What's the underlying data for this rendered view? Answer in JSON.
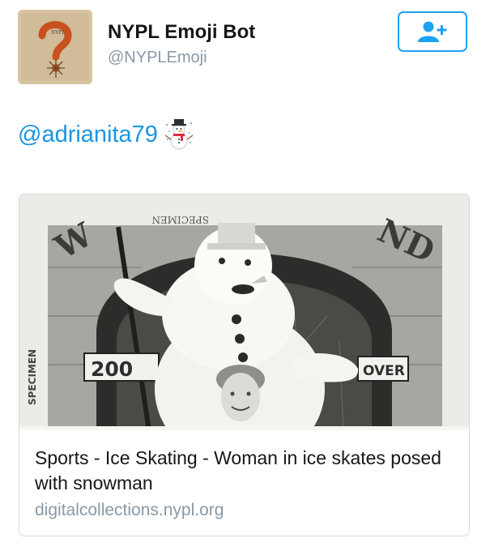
{
  "user": {
    "display_name": "NYPL Emoji Bot",
    "handle": "@NYPLEmoji",
    "avatar_icon": "question-mark-sun-icon"
  },
  "follow_button": {
    "icon": "add-user-icon",
    "accent_color": "#1da1f2"
  },
  "tweet": {
    "mention": "@adrianita79",
    "emoji_icon": "snowman-icon"
  },
  "card": {
    "image_description_icon": "snowman-photo",
    "photo_text": {
      "specimen_top": "SPECIMEN",
      "specimen_side": "SPECIMEN",
      "sign_left": "200",
      "sign_right": "OVER"
    },
    "title": "Sports - Ice Skating - Woman in ice skates posed with snowman",
    "domain": "digitalcollections.nypl.org"
  },
  "colors": {
    "link": "#1b95e0",
    "secondary_text": "#8899a6",
    "card_border": "#d4dbe1"
  }
}
